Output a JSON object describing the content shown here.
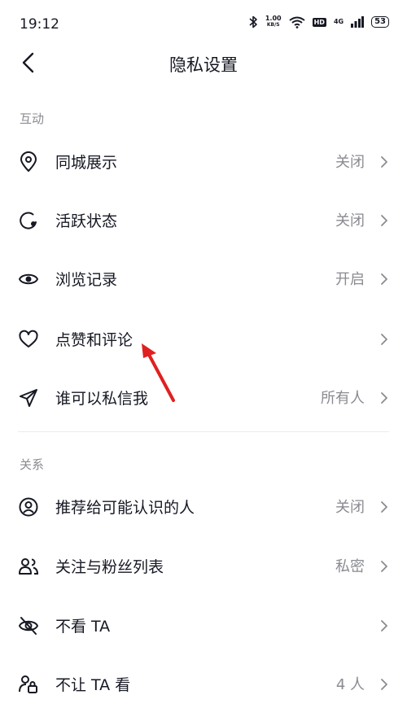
{
  "status": {
    "time": "19:12",
    "speed_value": "1.00",
    "speed_unit": "KB/S",
    "hd": "HD",
    "network": "4G",
    "battery": "53"
  },
  "nav": {
    "title": "隐私设置"
  },
  "sections": [
    {
      "label": "互动",
      "items": [
        {
          "icon": "location-pin-icon",
          "label": "同城展示",
          "value": "关闭"
        },
        {
          "icon": "activity-status-icon",
          "label": "活跃状态",
          "value": "关闭"
        },
        {
          "icon": "eye-icon",
          "label": "浏览记录",
          "value": "开启"
        },
        {
          "icon": "heart-icon",
          "label": "点赞和评论",
          "value": ""
        },
        {
          "icon": "send-icon",
          "label": "谁可以私信我",
          "value": "所有人"
        }
      ]
    },
    {
      "label": "关系",
      "items": [
        {
          "icon": "person-circle-icon",
          "label": "推荐给可能认识的人",
          "value": "关闭"
        },
        {
          "icon": "people-icon",
          "label": "关注与粉丝列表",
          "value": "私密"
        },
        {
          "icon": "eye-off-icon",
          "label": "不看 TA",
          "value": ""
        },
        {
          "icon": "person-lock-icon",
          "label": "不让 TA 看",
          "value": "4 人"
        }
      ]
    }
  ],
  "colors": {
    "text": "#161823",
    "secondary": "#8a8b91",
    "annotation_arrow": "#e02020"
  }
}
